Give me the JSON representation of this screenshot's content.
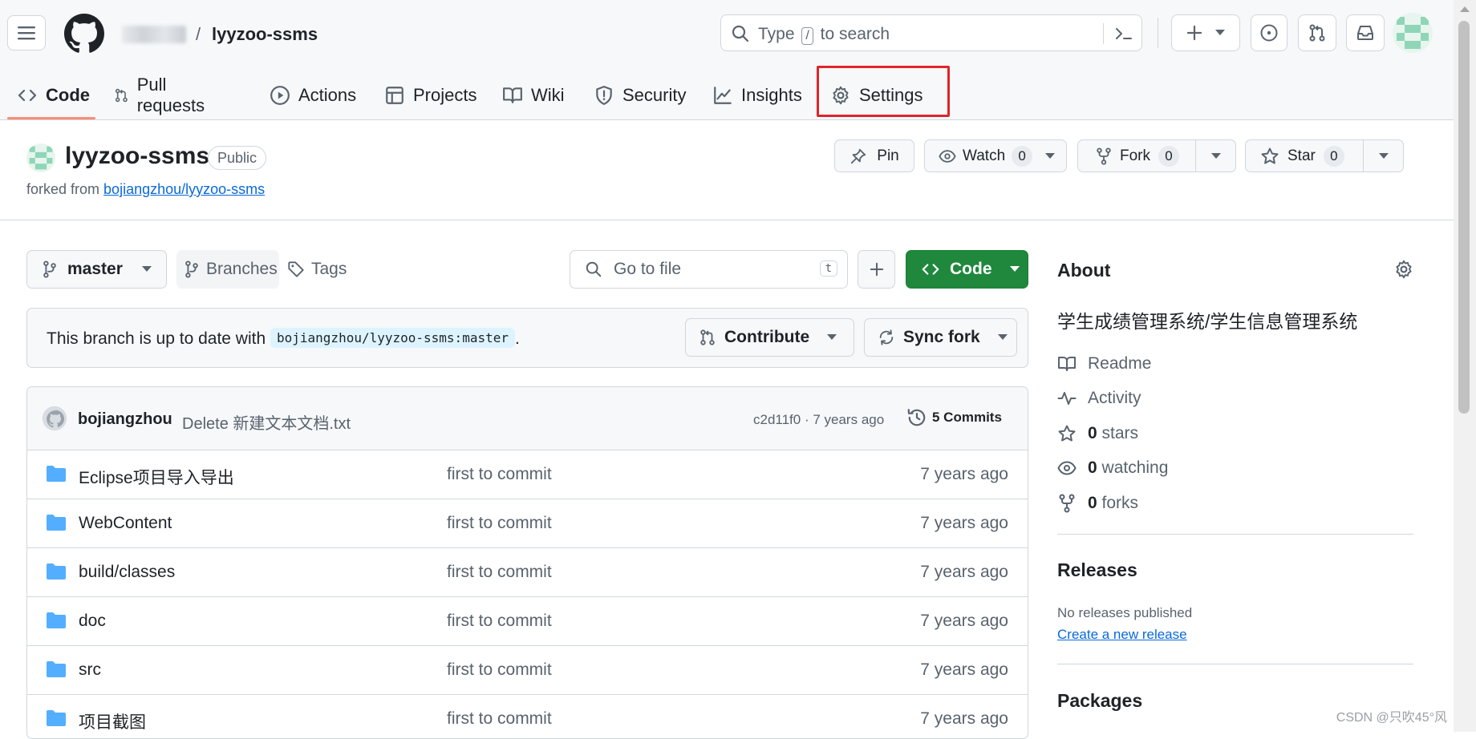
{
  "header": {
    "repo_name": "lyyzoo-ssms",
    "breadcrumb_separator": "/",
    "search": {
      "prefix": "Type",
      "key": "/",
      "suffix": "to search"
    }
  },
  "tabs": [
    {
      "label": "Code",
      "icon": "code-icon",
      "active": true
    },
    {
      "label": "Pull requests",
      "icon": "git-pull-request-icon"
    },
    {
      "label": "Actions",
      "icon": "play-icon"
    },
    {
      "label": "Projects",
      "icon": "table-icon"
    },
    {
      "label": "Wiki",
      "icon": "book-icon"
    },
    {
      "label": "Security",
      "icon": "shield-icon"
    },
    {
      "label": "Insights",
      "icon": "graph-icon"
    },
    {
      "label": "Settings",
      "icon": "gear-icon",
      "highlighted": true
    }
  ],
  "repo": {
    "name": "lyyzoo-ssms",
    "visibility": "Public",
    "forked_from_prefix": "forked from",
    "forked_from": "bojiangzhou/lyyzoo-ssms",
    "pin_label": "Pin",
    "watch_label": "Watch",
    "watch_count": "0",
    "fork_label": "Fork",
    "fork_count": "0",
    "star_label": "Star",
    "star_count": "0"
  },
  "filenav": {
    "branch": "master",
    "branches_label": "Branches",
    "tags_label": "Tags",
    "goto_placeholder": "Go to file",
    "goto_key": "t",
    "code_button": "Code"
  },
  "branch_status": {
    "message": "This branch is up to date with",
    "ref": "bojiangzhou/lyyzoo-ssms:master",
    "end": ".",
    "contribute_label": "Contribute",
    "sync_label": "Sync fork"
  },
  "latest_commit": {
    "author": "bojiangzhou",
    "message": "Delete 新建文本文档.txt",
    "meta": "c2d11f0 · 7 years ago",
    "commits_label": "5 Commits"
  },
  "files": [
    {
      "name": "Eclipse项目导入导出",
      "message": "first to commit",
      "date": "7 years ago"
    },
    {
      "name": "WebContent",
      "message": "first to commit",
      "date": "7 years ago"
    },
    {
      "name": "build/classes",
      "message": "first to commit",
      "date": "7 years ago"
    },
    {
      "name": "doc",
      "message": "first to commit",
      "date": "7 years ago"
    },
    {
      "name": "src",
      "message": "first to commit",
      "date": "7 years ago"
    },
    {
      "name": "项目截图",
      "message": "first to commit",
      "date": "7 years ago"
    }
  ],
  "about": {
    "title": "About",
    "description": "学生成绩管理系统/学生信息管理系统",
    "readme": "Readme",
    "activity": "Activity",
    "stars_count": "0",
    "stars_label": "stars",
    "watching_count": "0",
    "watching_label": "watching",
    "forks_count": "0",
    "forks_label": "forks"
  },
  "releases": {
    "title": "Releases",
    "empty": "No releases published",
    "create_link": "Create a new release"
  },
  "packages": {
    "title": "Packages"
  },
  "watermark": "CSDN @只吹45°风",
  "colors": {
    "primary_green": "#1f883d",
    "link_blue": "#0969da",
    "active_tab_underline": "#fd8c73",
    "highlight_box": "#e0242b",
    "folder_blue": "#54aeff"
  }
}
